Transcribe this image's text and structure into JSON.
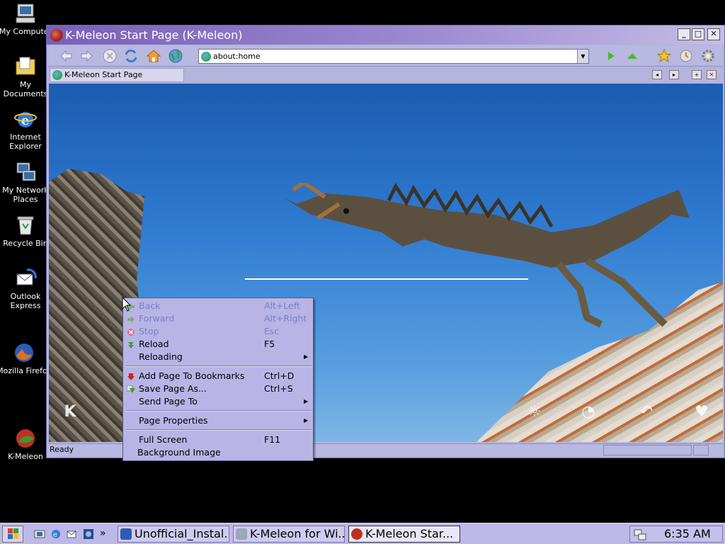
{
  "desktop": {
    "icons": [
      {
        "label": "My Computer",
        "icon": "my-computer-icon"
      },
      {
        "label": "My Documents",
        "icon": "my-documents-icon"
      },
      {
        "label": "Internet Explorer",
        "icon": "internet-explorer-icon"
      },
      {
        "label": "My Network Places",
        "icon": "network-places-icon"
      },
      {
        "label": "Recycle Bin",
        "icon": "recycle-bin-icon"
      },
      {
        "label": "Outlook Express",
        "icon": "outlook-express-icon"
      },
      {
        "label": "Mozilla Firefox",
        "icon": "firefox-icon"
      },
      {
        "label": "K-Meleon",
        "icon": "k-meleon-icon"
      }
    ]
  },
  "window": {
    "title": "K-Meleon Start Page (K-Meleon)",
    "controls": {
      "minimize": "_",
      "maximize": "□",
      "close": "✕"
    },
    "nav": {
      "url": "about:home",
      "buttons": [
        "back-icon",
        "forward-icon",
        "stop-icon",
        "reload-icon",
        "home-icon",
        "globe-icon",
        "go-icon",
        "up-icon",
        "bookmark-star-icon",
        "history-clock-icon",
        "settings-gear-icon"
      ]
    },
    "tab": {
      "label": "K-Meleon Start Page"
    },
    "status": {
      "text": "Ready"
    },
    "page": {
      "logo": "K",
      "icons": [
        "☼",
        "◔",
        "↶",
        "♥"
      ]
    }
  },
  "context_menu": {
    "items": [
      {
        "label": "Back",
        "shortcut": "Alt+Left",
        "disabled": true,
        "icon": "back-icon"
      },
      {
        "label": "Forward",
        "shortcut": "Alt+Right",
        "disabled": true,
        "icon": "forward-icon"
      },
      {
        "label": "Stop",
        "shortcut": "Esc",
        "disabled": true,
        "icon": "stop-icon"
      },
      {
        "label": "Reload",
        "shortcut": "F5",
        "disabled": false,
        "icon": "reload-icon"
      },
      {
        "label": "Reloading",
        "shortcut": "",
        "submenu": true
      },
      {
        "label": "Add Page To Bookmarks",
        "shortcut": "Ctrl+D",
        "icon": "bookmark-add-icon"
      },
      {
        "label": "Save Page As...",
        "shortcut": "Ctrl+S",
        "icon": "save-icon"
      },
      {
        "label": "Send Page To",
        "shortcut": "",
        "submenu": true
      },
      {
        "label": "Page Properties",
        "shortcut": "",
        "submenu": true
      },
      {
        "label": "Full Screen",
        "shortcut": "F11"
      },
      {
        "label": "Background Image",
        "shortcut": ""
      }
    ]
  },
  "taskbar": {
    "buttons": [
      {
        "label": "Unofficial_Instal...",
        "active": false
      },
      {
        "label": "K-Meleon for Wi...",
        "active": false
      },
      {
        "label": "K-Meleon Star...",
        "active": true
      }
    ],
    "overflow": "»",
    "clock": "6:35 AM"
  },
  "colors": {
    "menu_bg": "#b8b4e6",
    "disabled_text": "#7a80c0",
    "titlebar_start": "#7a5fb8",
    "taskbar_bg": "#bcb8e8"
  }
}
